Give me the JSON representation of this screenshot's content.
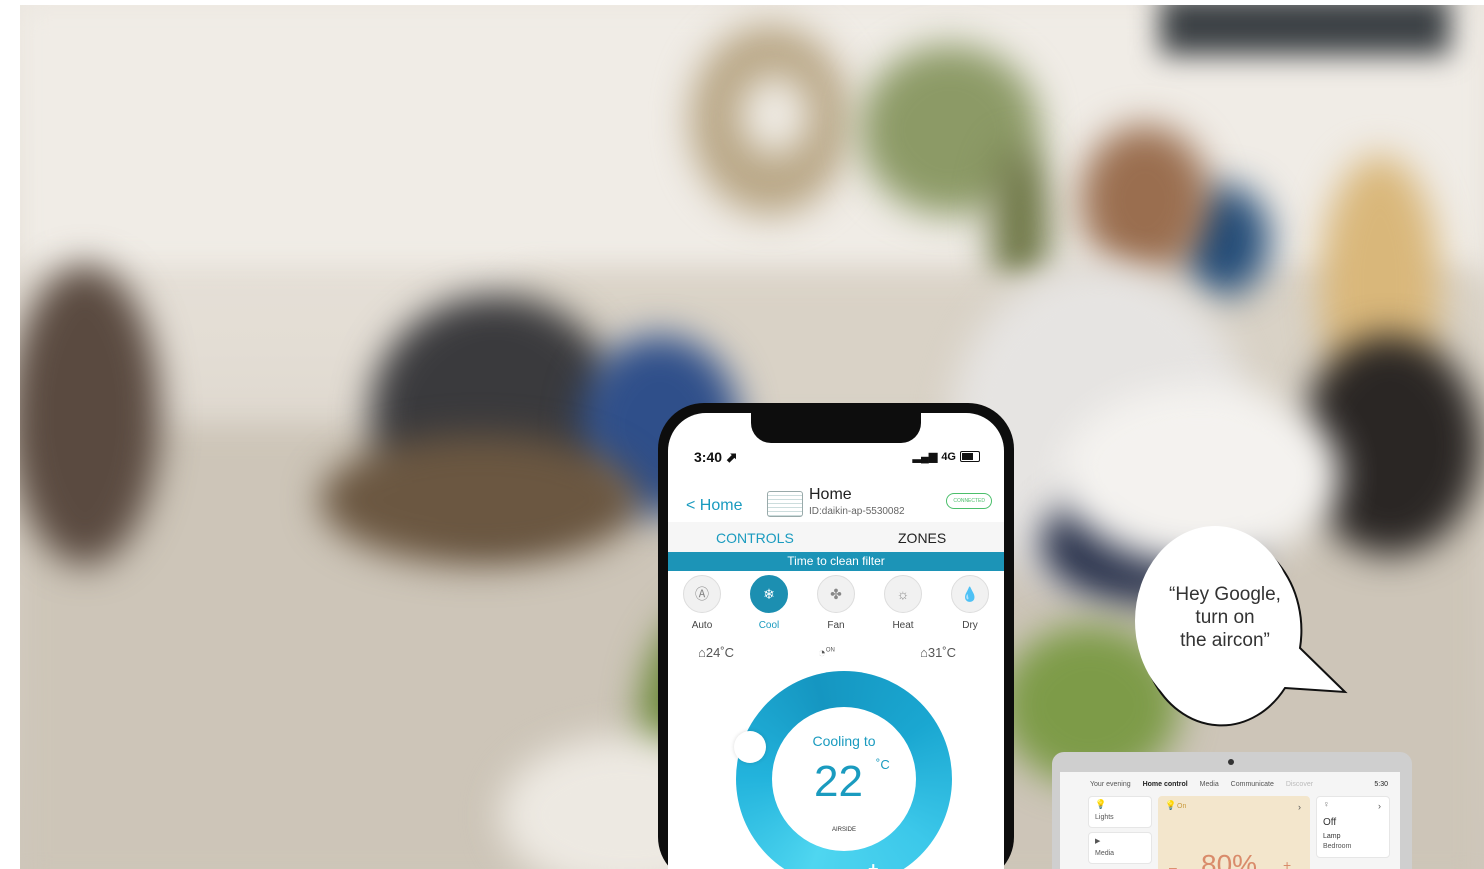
{
  "phone": {
    "status_time": "3:40 ⬈",
    "status_network": "4G",
    "nav_back": "< Home",
    "device_name": "Home",
    "device_id": "ID:daikin-ap-5530082",
    "connection_badge": "CONNECTED",
    "tabs": {
      "controls": "CONTROLS",
      "zones": "ZONES"
    },
    "banner": "Time to clean filter",
    "modes": [
      {
        "label": "Auto",
        "icon": "auto-icon",
        "active": false
      },
      {
        "label": "Cool",
        "icon": "snowflake-icon",
        "active": true
      },
      {
        "label": "Fan",
        "icon": "fan-icon",
        "active": false
      },
      {
        "label": "Heat",
        "icon": "sun-icon",
        "active": false
      },
      {
        "label": "Dry",
        "icon": "droplet-icon",
        "active": false
      }
    ],
    "indoor_temp": "24˚C",
    "timer_label": "ON",
    "outdoor_temp": "31˚C",
    "dial": {
      "status": "Cooling to",
      "setpoint": "22",
      "unit": "˚C",
      "zone_label": "AIRSIDE",
      "minus": "-",
      "plus": "+"
    },
    "colors": {
      "accent": "#1a9bbf",
      "banner": "#1c94b7",
      "connected": "#4bbf6b"
    }
  },
  "speech_bubble": {
    "line1": "“Hey Google,",
    "line2": "turn on",
    "line3": "the aircon”"
  },
  "hub": {
    "tabs": [
      "Your evening",
      "Home control",
      "Media",
      "Communicate",
      "Discover"
    ],
    "time": "5:30",
    "lights": "Lights",
    "media": "Media",
    "warm_status": "On",
    "brightness": "80%",
    "lamp_state": "Off",
    "lamp_name": "Lamp",
    "lamp_room": "Bedroom"
  }
}
